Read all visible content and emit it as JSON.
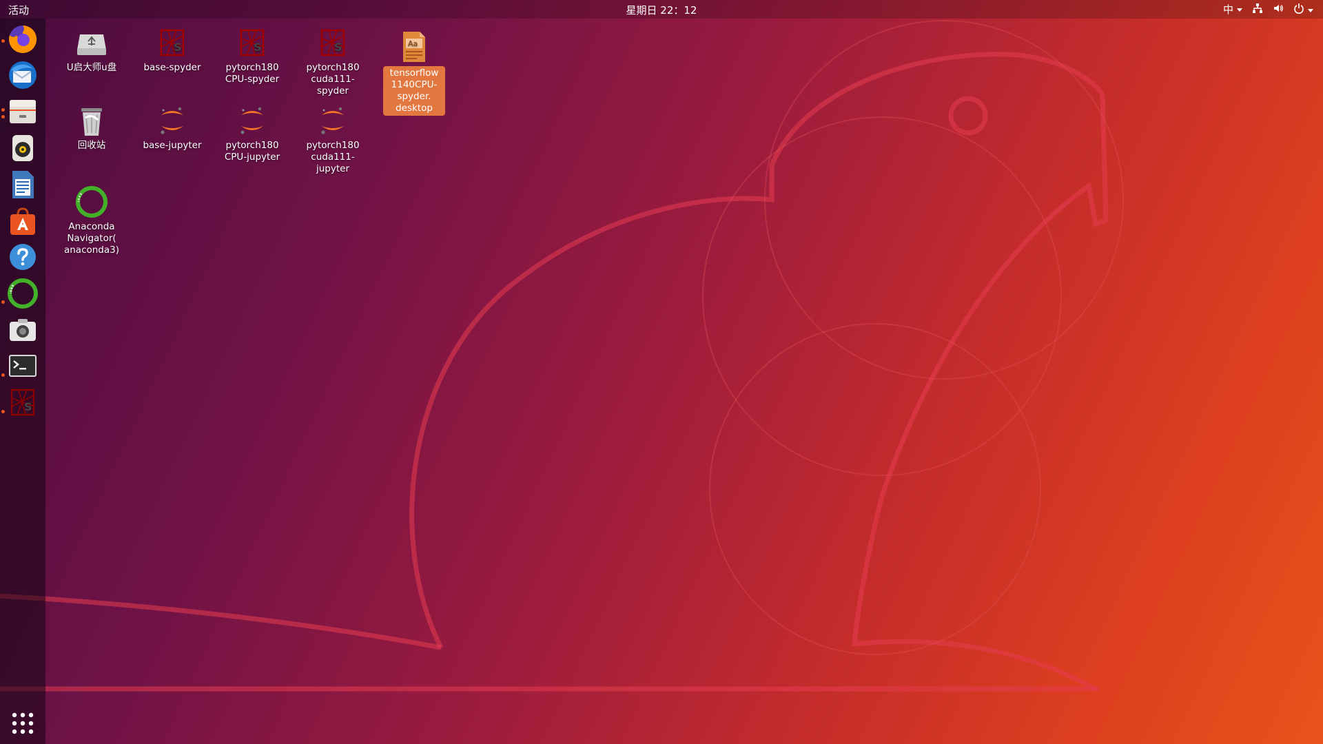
{
  "topbar": {
    "activities": "活动",
    "clock": "星期日 22：12",
    "ime": "中"
  },
  "dock": {
    "items": [
      {
        "icon": "firefox-icon",
        "running": true
      },
      {
        "icon": "thunderbird-icon",
        "running": false
      },
      {
        "icon": "files-icon",
        "running": true
      },
      {
        "icon": "rhythmbox-icon",
        "running": false
      },
      {
        "icon": "libreoffice-writer-icon",
        "running": false
      },
      {
        "icon": "ubuntu-software-icon",
        "running": false
      },
      {
        "icon": "help-icon",
        "running": false
      },
      {
        "icon": "anaconda-navigator-icon",
        "running": true
      },
      {
        "icon": "screenshot-icon",
        "running": false
      },
      {
        "icon": "terminal-icon",
        "running": true
      },
      {
        "icon": "spyder-icon",
        "running": true
      }
    ]
  },
  "desktop": {
    "icons": [
      {
        "label": "U启大师u盘",
        "icon": "usb-drive-icon"
      },
      {
        "label": "回收站",
        "icon": "trash-icon"
      },
      {
        "label": "Anaconda Navigator( anaconda3)",
        "icon": "anaconda-icon"
      },
      {
        "label": "base-spyder",
        "icon": "spyder-icon"
      },
      {
        "label": "base-jupyter",
        "icon": "jupyter-icon"
      },
      {
        "label": "pytorch180 CPU-spyder",
        "icon": "spyder-icon"
      },
      {
        "label": "pytorch180 CPU-jupyter",
        "icon": "jupyter-icon"
      },
      {
        "label": "pytorch180 cuda111-spyder",
        "icon": "spyder-icon"
      },
      {
        "label": "pytorch180 cuda111-jupyter",
        "icon": "jupyter-icon"
      },
      {
        "label": "tensorflow 1140CPU-spyder. desktop",
        "icon": "text-file-icon",
        "selected": true
      }
    ]
  },
  "colors": {
    "accent": "#e95420",
    "selection": "#e2773f"
  }
}
